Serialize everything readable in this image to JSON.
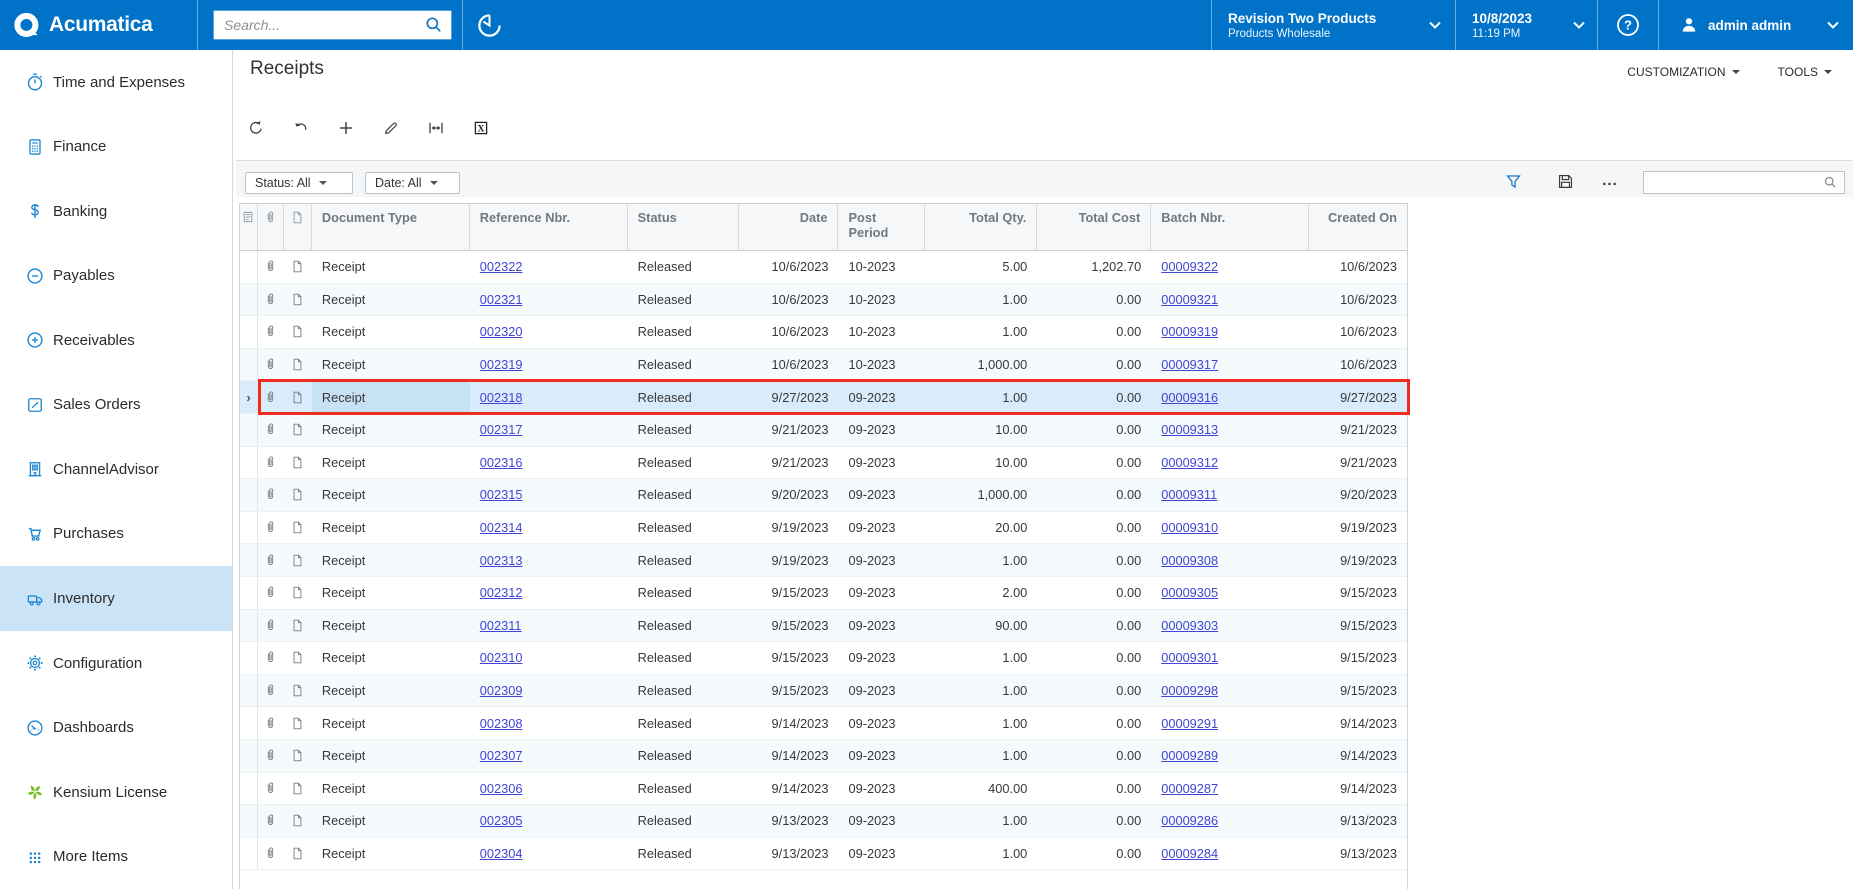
{
  "topbar": {
    "brand": "Acumatica",
    "search_placeholder": "Search...",
    "tenant": {
      "line1": "Revision Two Products",
      "line2": "Products Wholesale"
    },
    "datetime": {
      "date": "10/8/2023",
      "time": "11:19 PM"
    },
    "user": "admin admin"
  },
  "sidebar": {
    "items": [
      {
        "label": "Time and Expenses",
        "icon": "stopwatch-icon"
      },
      {
        "label": "Finance",
        "icon": "calculator-icon"
      },
      {
        "label": "Banking",
        "icon": "dollar-icon"
      },
      {
        "label": "Payables",
        "icon": "minus-circle-icon"
      },
      {
        "label": "Receivables",
        "icon": "plus-circle-icon"
      },
      {
        "label": "Sales Orders",
        "icon": "pencil-square-icon"
      },
      {
        "label": "ChannelAdvisor",
        "icon": "building-icon"
      },
      {
        "label": "Purchases",
        "icon": "cart-icon"
      },
      {
        "label": "Inventory",
        "icon": "truck-icon",
        "active": true
      },
      {
        "label": "Configuration",
        "icon": "gear-icon"
      },
      {
        "label": "Dashboards",
        "icon": "gauge-icon"
      },
      {
        "label": "Kensium License",
        "icon": "pinwheel-icon"
      },
      {
        "label": "More Items",
        "icon": "dots-grid-icon"
      }
    ],
    "active_color": "#cbe3f6",
    "icon_color": "#1e87d0",
    "pinwheel_color": "#76bc21"
  },
  "page": {
    "title": "Receipts",
    "customization_label": "CUSTOMIZATION",
    "tools_label": "TOOLS"
  },
  "filters": {
    "status": "Status: All",
    "date": "Date: All"
  },
  "grid": {
    "columns": [
      "Document Type",
      "Reference Nbr.",
      "Status",
      "Date",
      "Post Period",
      "Total Qty.",
      "Total Cost",
      "Batch Nbr.",
      "Created On"
    ],
    "rows": [
      {
        "doc_type": "Receipt",
        "ref": "002322",
        "status": "Released",
        "date": "10/6/2023",
        "period": "10-2023",
        "qty": "5.00",
        "cost": "1,202.70",
        "batch": "00009322",
        "created": "10/6/2023"
      },
      {
        "doc_type": "Receipt",
        "ref": "002321",
        "status": "Released",
        "date": "10/6/2023",
        "period": "10-2023",
        "qty": "1.00",
        "cost": "0.00",
        "batch": "00009321",
        "created": "10/6/2023"
      },
      {
        "doc_type": "Receipt",
        "ref": "002320",
        "status": "Released",
        "date": "10/6/2023",
        "period": "10-2023",
        "qty": "1.00",
        "cost": "0.00",
        "batch": "00009319",
        "created": "10/6/2023"
      },
      {
        "doc_type": "Receipt",
        "ref": "002319",
        "status": "Released",
        "date": "10/6/2023",
        "period": "10-2023",
        "qty": "1,000.00",
        "cost": "0.00",
        "batch": "00009317",
        "created": "10/6/2023"
      },
      {
        "doc_type": "Receipt",
        "ref": "002318",
        "status": "Released",
        "date": "9/27/2023",
        "period": "09-2023",
        "qty": "1.00",
        "cost": "0.00",
        "batch": "00009316",
        "created": "9/27/2023",
        "selected": true
      },
      {
        "doc_type": "Receipt",
        "ref": "002317",
        "status": "Released",
        "date": "9/21/2023",
        "period": "09-2023",
        "qty": "10.00",
        "cost": "0.00",
        "batch": "00009313",
        "created": "9/21/2023"
      },
      {
        "doc_type": "Receipt",
        "ref": "002316",
        "status": "Released",
        "date": "9/21/2023",
        "period": "09-2023",
        "qty": "10.00",
        "cost": "0.00",
        "batch": "00009312",
        "created": "9/21/2023"
      },
      {
        "doc_type": "Receipt",
        "ref": "002315",
        "status": "Released",
        "date": "9/20/2023",
        "period": "09-2023",
        "qty": "1,000.00",
        "cost": "0.00",
        "batch": "00009311",
        "created": "9/20/2023"
      },
      {
        "doc_type": "Receipt",
        "ref": "002314",
        "status": "Released",
        "date": "9/19/2023",
        "period": "09-2023",
        "qty": "20.00",
        "cost": "0.00",
        "batch": "00009310",
        "created": "9/19/2023"
      },
      {
        "doc_type": "Receipt",
        "ref": "002313",
        "status": "Released",
        "date": "9/19/2023",
        "period": "09-2023",
        "qty": "1.00",
        "cost": "0.00",
        "batch": "00009308",
        "created": "9/19/2023"
      },
      {
        "doc_type": "Receipt",
        "ref": "002312",
        "status": "Released",
        "date": "9/15/2023",
        "period": "09-2023",
        "qty": "2.00",
        "cost": "0.00",
        "batch": "00009305",
        "created": "9/15/2023"
      },
      {
        "doc_type": "Receipt",
        "ref": "002311",
        "status": "Released",
        "date": "9/15/2023",
        "period": "09-2023",
        "qty": "90.00",
        "cost": "0.00",
        "batch": "00009303",
        "created": "9/15/2023"
      },
      {
        "doc_type": "Receipt",
        "ref": "002310",
        "status": "Released",
        "date": "9/15/2023",
        "period": "09-2023",
        "qty": "1.00",
        "cost": "0.00",
        "batch": "00009301",
        "created": "9/15/2023"
      },
      {
        "doc_type": "Receipt",
        "ref": "002309",
        "status": "Released",
        "date": "9/15/2023",
        "period": "09-2023",
        "qty": "1.00",
        "cost": "0.00",
        "batch": "00009298",
        "created": "9/15/2023"
      },
      {
        "doc_type": "Receipt",
        "ref": "002308",
        "status": "Released",
        "date": "9/14/2023",
        "period": "09-2023",
        "qty": "1.00",
        "cost": "0.00",
        "batch": "00009291",
        "created": "9/14/2023"
      },
      {
        "doc_type": "Receipt",
        "ref": "002307",
        "status": "Released",
        "date": "9/14/2023",
        "period": "09-2023",
        "qty": "1.00",
        "cost": "0.00",
        "batch": "00009289",
        "created": "9/14/2023"
      },
      {
        "doc_type": "Receipt",
        "ref": "002306",
        "status": "Released",
        "date": "9/14/2023",
        "period": "09-2023",
        "qty": "400.00",
        "cost": "0.00",
        "batch": "00009287",
        "created": "9/14/2023"
      },
      {
        "doc_type": "Receipt",
        "ref": "002305",
        "status": "Released",
        "date": "9/13/2023",
        "period": "09-2023",
        "qty": "1.00",
        "cost": "0.00",
        "batch": "00009286",
        "created": "9/13/2023"
      },
      {
        "doc_type": "Receipt",
        "ref": "002304",
        "status": "Released",
        "date": "9/13/2023",
        "period": "09-2023",
        "qty": "1.00",
        "cost": "0.00",
        "batch": "00009284",
        "created": "9/13/2023"
      }
    ],
    "selected_border_color": "#ee2c20"
  }
}
